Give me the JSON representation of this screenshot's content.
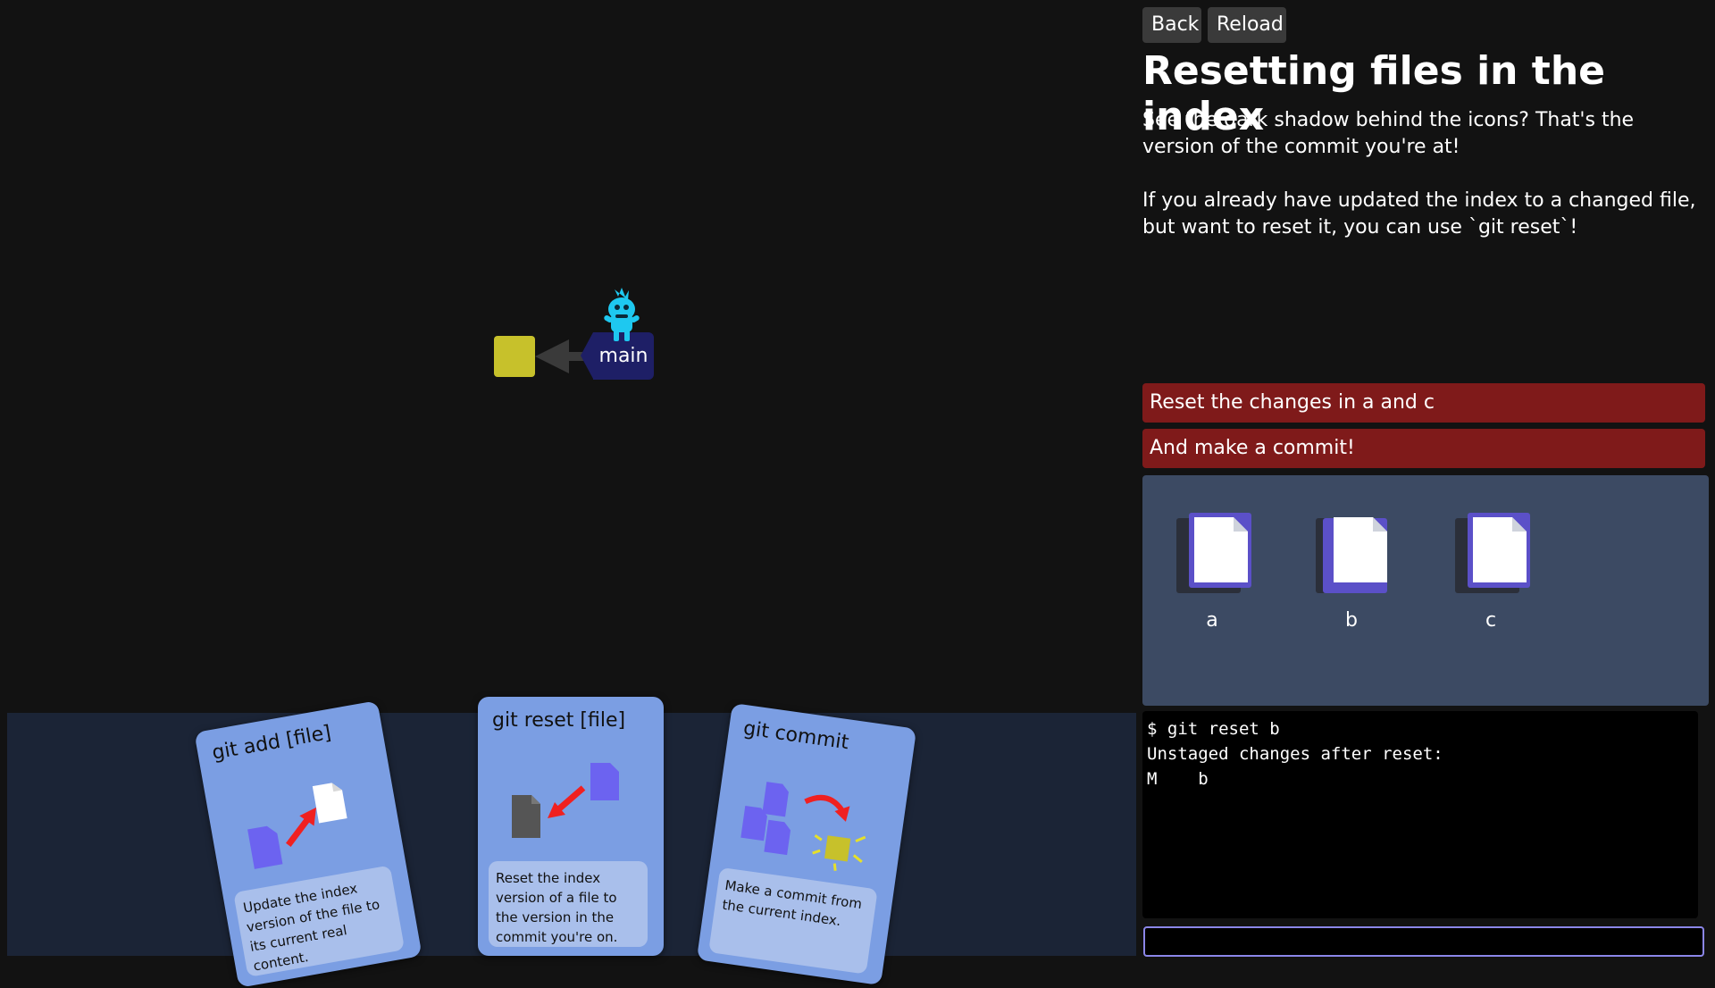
{
  "graph": {
    "branch_label": "main",
    "commit_color": "#c7c12b",
    "branch_color": "#1e1f66"
  },
  "cards": [
    {
      "title": "git add [file]",
      "description": "Update the index version of the file to its current real content."
    },
    {
      "title": "git reset [file]",
      "description": "Reset the index version of a file to the version in the commit you're on."
    },
    {
      "title": "git commit",
      "description": "Make a commit from the current index."
    }
  ],
  "header": {
    "back_label": "Back",
    "reload_label": "Reload"
  },
  "level": {
    "title": "Resetting files in the index",
    "paragraphs": [
      "See the dark shadow behind the icons? That's the version of the commit you're at!",
      "If you already have updated the index to a changed file, but want to reset it, you can use `git reset`!"
    ]
  },
  "goals": [
    "Reset the changes in a and c",
    "And make a commit!"
  ],
  "files": [
    {
      "name": "a",
      "icon": "file-icon"
    },
    {
      "name": "b",
      "icon": "file-icon"
    },
    {
      "name": "c",
      "icon": "file-icon"
    }
  ],
  "terminal": {
    "lines": [
      "$ git reset b",
      "Unstaged changes after reset:",
      "M    b"
    ],
    "input_value": ""
  },
  "colors": {
    "goal_bg": "#7f1a1a",
    "files_bg": "#3c4a63",
    "card_bg": "#7b9ee3",
    "index_purple": "#5b50c8"
  }
}
